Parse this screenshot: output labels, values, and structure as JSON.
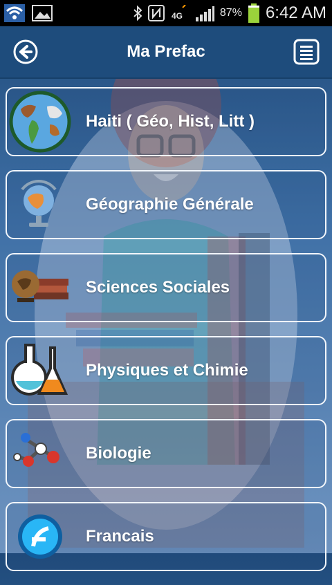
{
  "status_bar": {
    "battery_percent": "87%",
    "network": "4G",
    "time": "6:42 AM",
    "icons": [
      "wifi-icon",
      "image-icon",
      "bluetooth-icon",
      "nfc-icon",
      "signal-icon",
      "battery-icon"
    ]
  },
  "header": {
    "title": "Ma Prefac",
    "back_icon": "back-arrow-icon",
    "menu_icon": "menu-icon"
  },
  "menu_items": [
    {
      "label": "Haiti ( Géo, Hist, Litt )",
      "icon": "globe-icon"
    },
    {
      "label": "Géographie Générale",
      "icon": "desk-globe-icon"
    },
    {
      "label": "Sciences Sociales",
      "icon": "antique-globe-books-icon"
    },
    {
      "label": "Physiques et Chimie",
      "icon": "lab-flask-icon"
    },
    {
      "label": "Biologie",
      "icon": "molecule-icon"
    },
    {
      "label": "Francais",
      "icon": "french-app-icon"
    }
  ],
  "colors": {
    "header": "#1e4c7c",
    "card_border": "#f2f6fb",
    "text": "#ffffff"
  }
}
